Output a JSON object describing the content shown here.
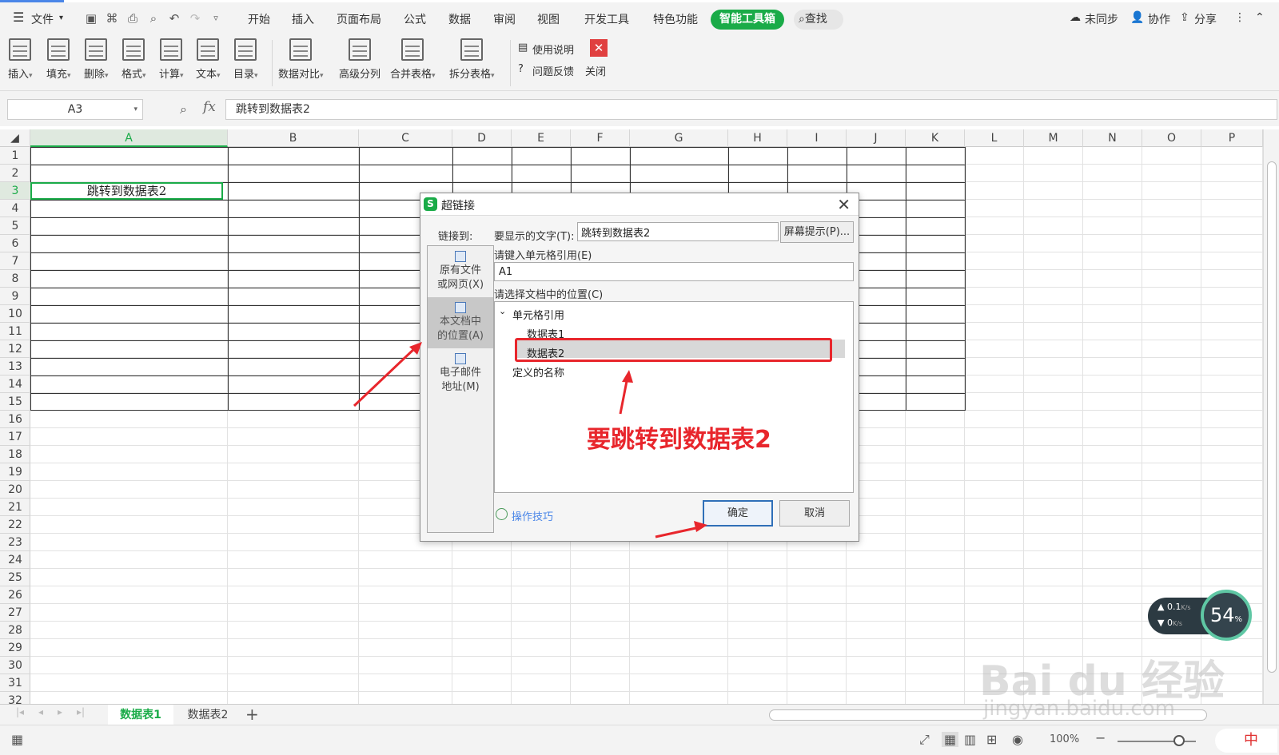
{
  "menu": {
    "file": "文件",
    "tabs": [
      "开始",
      "插入",
      "页面布局",
      "公式",
      "数据",
      "审阅",
      "视图",
      "开发工具",
      "特色功能"
    ],
    "active_tab": "智能工具箱",
    "search": "查找",
    "unsynced": "未同步",
    "collab": "协作",
    "share": "分享"
  },
  "ribbon": {
    "buttons": [
      "插入",
      "填充",
      "删除",
      "格式",
      "计算",
      "文本",
      "目录",
      "数据对比",
      "高级分列",
      "合并表格",
      "拆分表格"
    ],
    "manual": "使用说明",
    "feedback": "问题反馈",
    "close": "关闭"
  },
  "formula_bar": {
    "name_box": "A3",
    "fx": "fx",
    "value": "跳转到数据表2"
  },
  "grid": {
    "columns": [
      "A",
      "B",
      "C",
      "D",
      "E",
      "F",
      "G",
      "H",
      "I",
      "J",
      "K",
      "L",
      "M",
      "N",
      "O",
      "P"
    ],
    "rows": [
      "1",
      "2",
      "3",
      "4",
      "5",
      "6",
      "7",
      "8",
      "9",
      "10",
      "11",
      "12",
      "13",
      "14",
      "15",
      "16",
      "17",
      "18",
      "19",
      "20",
      "21",
      "22",
      "23",
      "24",
      "25",
      "26",
      "27",
      "28",
      "29",
      "30",
      "31",
      "32"
    ],
    "a3": "跳转到数据表2"
  },
  "sheets": {
    "tab1": "数据表1",
    "tab2": "数据表2",
    "add": "+"
  },
  "status": {
    "zoom": "100%",
    "ime": "中"
  },
  "dialog": {
    "title": "超链接",
    "link_to": "链接到:",
    "display_label": "要显示的文字(T):",
    "display_value": "跳转到数据表2",
    "screen_tip": "屏幕提示(P)...",
    "targets": [
      {
        "l1": "原有文件",
        "l2": "或网页(X)"
      },
      {
        "l1": "本文档中",
        "l2": "的位置(A)"
      },
      {
        "l1": "电子邮件",
        "l2": "地址(M)"
      }
    ],
    "cellref_label": "请键入单元格引用(E)",
    "cellref_value": "A1",
    "location_label": "请选择文档中的位置(C)",
    "tree": {
      "root": "单元格引用",
      "item1": "数据表1",
      "item2": "数据表2",
      "defined": "定义的名称"
    },
    "annotation": "要跳转到数据表2",
    "tips": "操作技巧",
    "ok": "确定",
    "cancel": "取消"
  },
  "speed_widget": {
    "up": "0.1",
    "down": "0",
    "unit": "K/s",
    "percent": "54",
    "percent_sign": "%"
  },
  "watermark": {
    "logo": "Bai du 经验",
    "url": "jingyan.baidu.com"
  },
  "colors": {
    "accent": "#1aab48",
    "annotation": "#e8262c",
    "primary_btn": "#2f6fb8"
  }
}
